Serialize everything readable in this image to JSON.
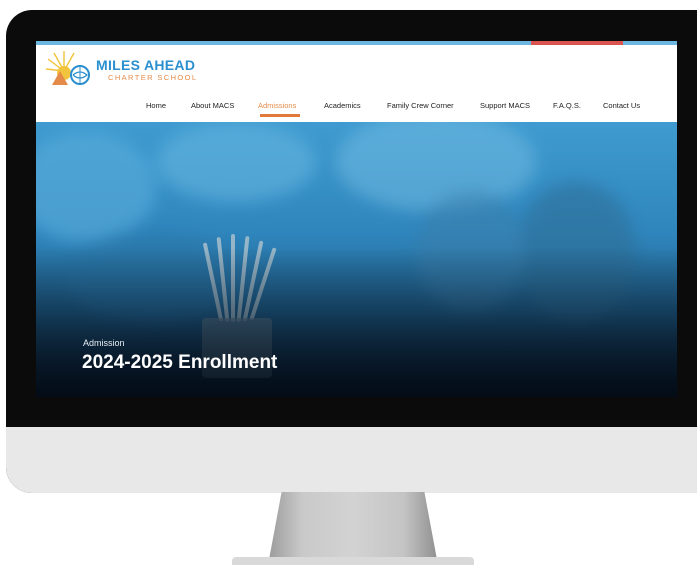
{
  "site": {
    "logo": {
      "title": "MILES AHEAD",
      "subtitle": "CHARTER SCHOOL"
    },
    "nav": [
      {
        "label": "Home",
        "active": false
      },
      {
        "label": "About MACS",
        "active": false
      },
      {
        "label": "Admissions",
        "active": true
      },
      {
        "label": "Academics",
        "active": false
      },
      {
        "label": "Family Crew Corner",
        "active": false
      },
      {
        "label": "Support MACS",
        "active": false
      },
      {
        "label": "F.A.Q.S.",
        "active": false
      },
      {
        "label": "Contact Us",
        "active": false
      }
    ]
  },
  "hero": {
    "kicker": "Admission",
    "title": "2024-2025 Enrollment"
  },
  "colors": {
    "brand_blue": "#2a8fcf",
    "accent_orange": "#e07a3a",
    "top_accent_red": "#d9534f",
    "hero_blue": "#2f86bd"
  },
  "icons": {
    "logo_mark": "sun-globe-logo-icon"
  }
}
